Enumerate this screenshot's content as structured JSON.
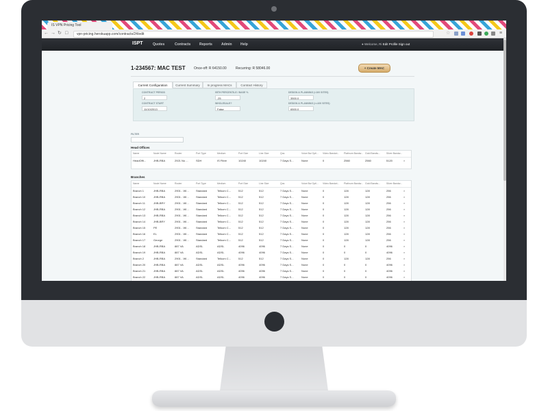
{
  "browser": {
    "tab_title": "IS VPN Pricing Tool",
    "url": "vpn-pricing.herokuapp.com/contracts/24/edit"
  },
  "navbar": {
    "brand": "ISPT",
    "links": [
      "Quotes",
      "Contracts",
      "Reports",
      "Admin",
      "Help"
    ],
    "welcome": "Welcome, Ri",
    "edit_profile": "Edit Profile",
    "sign_out": "Sign out"
  },
  "contract": {
    "title": "1-234567: MAC TEST",
    "once_off": "Once-off: R 64150.00",
    "recurring": "Recurring: R 58046.00",
    "create_mac": "+ Create MAC"
  },
  "tabs": [
    "Current Configuration",
    "Current Summary",
    "In progress MACs",
    "Contract History"
  ],
  "config": {
    "contract_period_label": "CONTRACT PERIOD",
    "contract_period": "2",
    "contract_start_label": "CONTRACT START",
    "contract_start": "11/10/2013",
    "percentile_label": "95TH PERCENTILE / BASE %",
    "percentile": ".25",
    "wholesale_label": "WHOLESALE?",
    "wholesale": "False",
    "dp_small_label": "DESIGN & PLANNING (<100 SITES)",
    "dp_small": "3500.0",
    "dp_large_label": "DESIGN & PLANNING (>=100 SITES)",
    "dp_large": "6500.0"
  },
  "filter_label": "FILTER",
  "head_offices_title": "Head Offices",
  "branches_title": "Branches",
  "columns": [
    "Name",
    "Node Name",
    "Router",
    "Port Type",
    "Medium",
    "Port Size",
    "Line Size",
    "Qos",
    "Voice Bw Opti...",
    "Video Bandwi...",
    "Platinum Bandw...",
    "Gold Bandw...",
    "Silver Bandw..."
  ],
  "head_offices": [
    [
      "HeadOffi...",
      "JHB-RBA",
      "2921 No ...",
      "SDH",
      "IS Fibre",
      "10240",
      "10240",
      "7 Days S...",
      "None",
      "0",
      "2560",
      "2560",
      "5120"
    ]
  ],
  "branches": [
    [
      "Branch 1",
      "JHB-RBA",
      "2901 - WI...",
      "Standard",
      "Telkom C...",
      "512",
      "512",
      "7 Days S...",
      "None",
      "0",
      "128",
      "128",
      "256"
    ],
    [
      "Branch 10",
      "JHB-RBA",
      "2901 - WI...",
      "Standard",
      "Telkom C...",
      "512",
      "512",
      "7 Days S...",
      "None",
      "0",
      "128",
      "128",
      "256"
    ],
    [
      "Branch 11",
      "JHB-BRY",
      "2901 - WI...",
      "Standard",
      "Telkom C...",
      "512",
      "512",
      "7 Days S...",
      "None",
      "0",
      "128",
      "128",
      "256"
    ],
    [
      "Branch 12",
      "JHB-RBA",
      "2901 - WI...",
      "Standard",
      "Telkom C...",
      "512",
      "512",
      "7 Days S...",
      "None",
      "0",
      "128",
      "128",
      "256"
    ],
    [
      "Branch 13",
      "JHB-RBA",
      "2901 - WI...",
      "Standard",
      "Telkom C...",
      "512",
      "512",
      "7 Days S...",
      "None",
      "0",
      "128",
      "128",
      "256"
    ],
    [
      "Branch 14",
      "JHB-BRY",
      "2901 - WI...",
      "Standard",
      "Telkom C...",
      "512",
      "512",
      "7 Days S...",
      "None",
      "0",
      "128",
      "128",
      "256"
    ],
    [
      "Branch 15",
      "PE",
      "2901 - WI...",
      "Standard",
      "Telkom C...",
      "512",
      "512",
      "7 Days S...",
      "None",
      "0",
      "128",
      "128",
      "256"
    ],
    [
      "Branch 16",
      "EL",
      "2901 - WI...",
      "Standard",
      "Telkom C...",
      "512",
      "512",
      "7 Days S...",
      "None",
      "0",
      "128",
      "128",
      "256"
    ],
    [
      "Branch 17",
      "George",
      "2901 - WI...",
      "Standard",
      "Telkom C...",
      "512",
      "512",
      "7 Days S...",
      "None",
      "0",
      "128",
      "128",
      "256"
    ],
    [
      "Branch 18",
      "JHB-RBA",
      "887 VA",
      "ADSL",
      "ADSL",
      "4096",
      "4096",
      "7 Days S...",
      "None",
      "0",
      "0",
      "0",
      "4096"
    ],
    [
      "Branch 19",
      "JHB-RBA",
      "887 VA",
      "ADSL",
      "ADSL",
      "4096",
      "4096",
      "7 Days S...",
      "None",
      "0",
      "0",
      "0",
      "4096"
    ],
    [
      "Branch 2",
      "JHB-RBA",
      "2901 - WI...",
      "Standard",
      "Telkom C...",
      "512",
      "512",
      "7 Days S...",
      "None",
      "0",
      "128",
      "128",
      "256"
    ],
    [
      "Branch 20",
      "JHB-RBA",
      "887 VA",
      "ADSL",
      "ADSL",
      "4096",
      "4096",
      "7 Days S...",
      "None",
      "0",
      "0",
      "0",
      "4096"
    ],
    [
      "Branch 21",
      "JHB-RBA",
      "887 VA",
      "ADSL",
      "ADSL",
      "4096",
      "4096",
      "7 Days S...",
      "None",
      "0",
      "0",
      "0",
      "4096"
    ],
    [
      "Branch 22",
      "JHB-RBA",
      "887 VA",
      "ADSL",
      "ADSL",
      "4096",
      "4096",
      "7 Days S...",
      "None",
      "0",
      "0",
      "0",
      "4096"
    ]
  ],
  "colors": {
    "navbar": "#1f2226",
    "panel": "#e4eff0",
    "accent_button": "#d6ad6c"
  }
}
